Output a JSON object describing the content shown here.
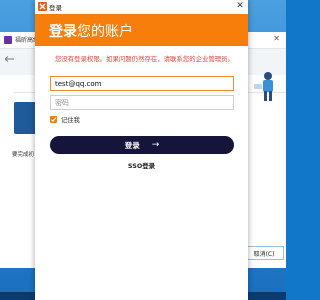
{
  "background_app": {
    "title": "福昕高级",
    "caption": "要完成初",
    "cancel_label": "取消(C)"
  },
  "dialog": {
    "title": "登录",
    "header_bold": "登录",
    "header_rest": "您的账户",
    "notice": "您没有登录权限。如果问题仍然存在，请联系您的企业管理员。",
    "email_value": "test@qq.com",
    "password_placeholder": "密码",
    "remember_label": "记住我",
    "remember_checked": true,
    "login_label": "登录",
    "login_arrow": "→",
    "sso_label": "SSO登录"
  },
  "colors": {
    "accent": "#f77e0a",
    "button": "#15143a",
    "error_text": "#e0453b"
  }
}
